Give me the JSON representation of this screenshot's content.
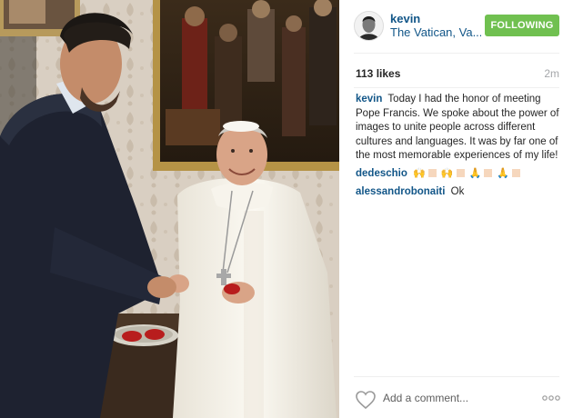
{
  "post": {
    "username": "kevin",
    "location": "The Vatican, Va...",
    "follow_label": "FOLLOWING",
    "likes": "113 likes",
    "time": "2m",
    "add_comment_placeholder": "Add a comment..."
  },
  "comments": [
    {
      "user": "kevin",
      "text": "Today I had the honor of meeting Pope Francis. We spoke about the power of images to unite people across different cultures and languages. It was by far one of the most memorable experiences of my life!"
    },
    {
      "user": "dedeschio",
      "emojis": [
        "raised-hands",
        "skin-tone",
        "raised-hands",
        "skin-tone",
        "folded-hands",
        "skin-tone",
        "folded-hands",
        "skin-tone"
      ]
    },
    {
      "user": "alessandrobonaiti",
      "text": "Ok"
    }
  ],
  "colors": {
    "link": "#125688",
    "follow_button": "#70c050",
    "time": "#a5a7aa",
    "divider": "#efefef"
  },
  "icons": [
    "heart-icon",
    "more-options-icon",
    "raised-hands-emoji",
    "folded-hands-emoji"
  ]
}
